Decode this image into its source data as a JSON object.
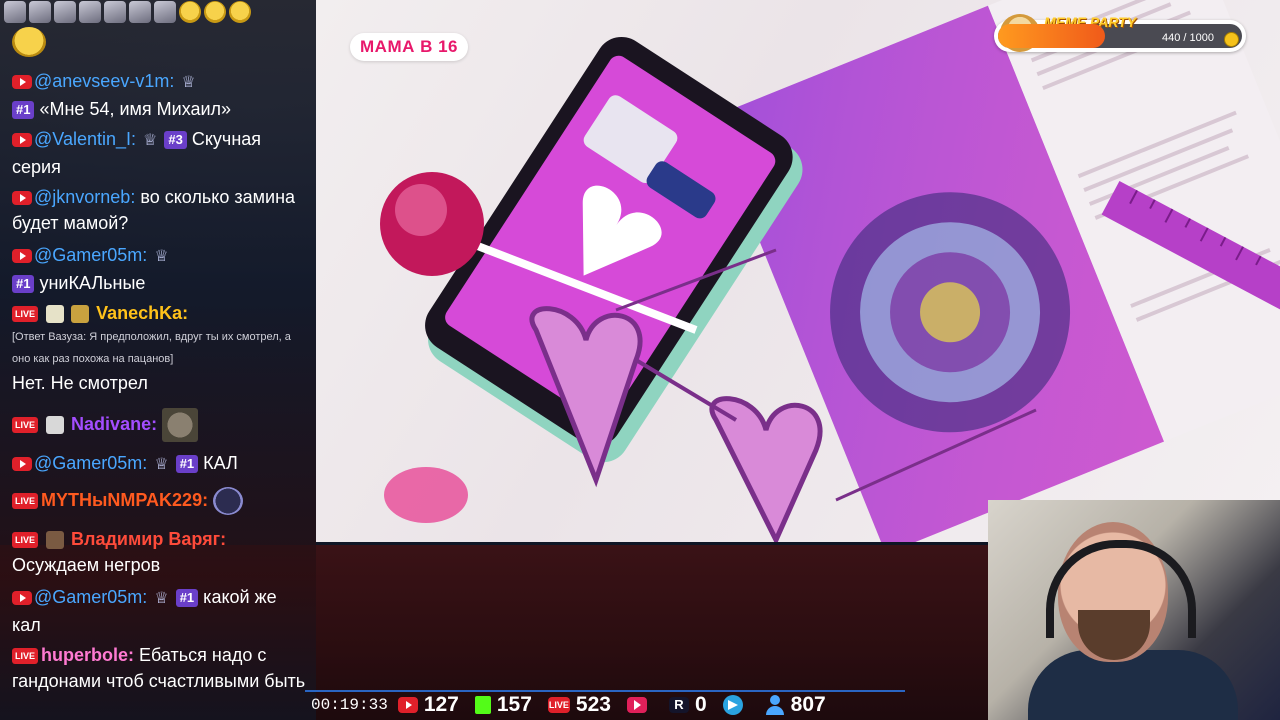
{
  "chat": {
    "emotes_top_row": [
      "girl-emote",
      "girl-emote",
      "girl-emote",
      "girl-emote",
      "girl-emote",
      "smile-emote",
      "smile-emote",
      "smile-emote"
    ],
    "messages": [
      {
        "platform": "youtube",
        "user": "@anevseev-v1m:",
        "crown": "♕",
        "rank": "#1",
        "text": "«Мне 54, имя Михаил»"
      },
      {
        "platform": "youtube",
        "user": "@Valentin_I:",
        "crown": "♕",
        "rank": "#3",
        "text": "Скучная серия"
      },
      {
        "platform": "youtube",
        "user": "@jknvorneb:",
        "text": "во сколько замина будет мамой?"
      },
      {
        "platform": "youtube",
        "user": "@Gamer05m:",
        "crown": "♕",
        "rank": "#1",
        "text": "униКАЛьные"
      },
      {
        "platform": "live",
        "user": "VanechKa:",
        "note": "[Ответ Вазуза: Я предположил, вдруг ты их смотрел, а оно как раз похожа на пацанов]",
        "text": "Нет. Не смотрел"
      },
      {
        "platform": "live",
        "user": "Nadivane:"
      },
      {
        "platform": "youtube",
        "user": "@Gamer05m:",
        "crown": "♕",
        "rank": "#1",
        "text": "КАЛ"
      },
      {
        "platform": "live",
        "user": "MYTHыNMPAK229:"
      },
      {
        "platform": "live",
        "user": "Владимир Варяг:",
        "text": "Осуждаем негров"
      },
      {
        "platform": "youtube",
        "user": "@Gamer05m:",
        "crown": "♕",
        "rank": "#1",
        "text": "какой же кал"
      },
      {
        "platform": "live",
        "user": "huperbole:",
        "text": "Ебаться надо с гандонами чтоб счастливыми быть"
      }
    ],
    "live_badge": "LIVE"
  },
  "video": {
    "show_tag": "МАМА В 16"
  },
  "meme_party": {
    "title": "MEME PARTY",
    "count": "440 / 1000",
    "progress": 0.44
  },
  "stats": {
    "time": "00:19:33",
    "youtube": "127",
    "kick": "157",
    "live_label": "LIVE",
    "live": "523",
    "rutube_label": "R",
    "rutube": "0",
    "viewers": "807"
  }
}
